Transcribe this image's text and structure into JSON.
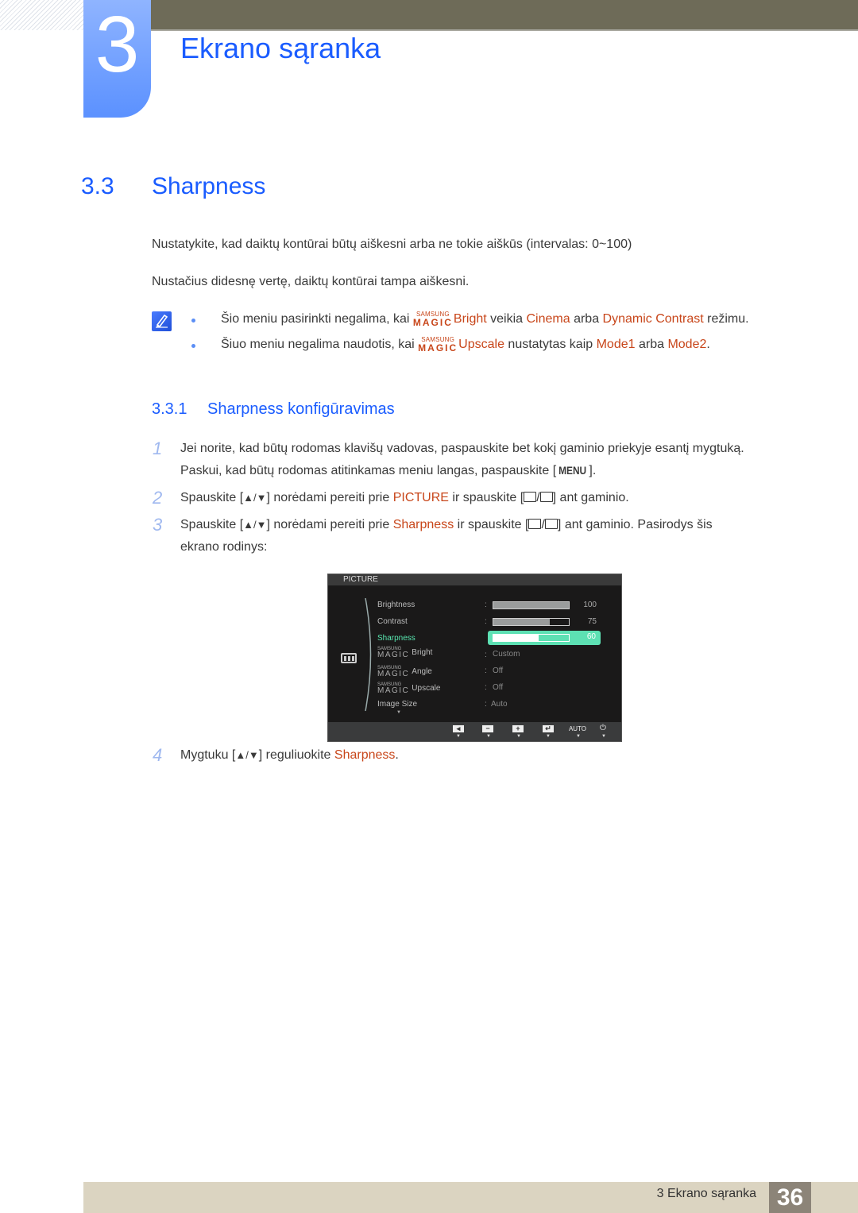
{
  "chapter": {
    "number": "3",
    "title": "Ekrano sąranka"
  },
  "section": {
    "number": "3.3",
    "title": "Sharpness"
  },
  "intro": [
    "Nustatykite, kad daiktų kontūrai būtų aiškesni arba ne tokie aiškūs (intervalas: 0~100)",
    "Nustačius didesnę vertę, daiktų kontūrai tampa aiškesni."
  ],
  "notes": [
    {
      "pre": "Šio meniu pasirinkti negalima, kai ",
      "magic_s": "SAMSUNG",
      "magic_m": "MAGIC",
      "feature": "Bright",
      "mid1": " veikia ",
      "opt1": "Cinema",
      "mid2": " arba ",
      "opt2": "Dynamic Contrast",
      "post": " režimu."
    },
    {
      "pre": "Šiuo meniu negalima naudotis, kai ",
      "magic_s": "SAMSUNG",
      "magic_m": "MAGIC",
      "feature": "Upscale",
      "mid1": " nustatytas kaip ",
      "opt1": "Mode1",
      "mid2": " arba ",
      "opt2": "Mode2",
      "post": "."
    }
  ],
  "subsection": {
    "number": "3.3.1",
    "title": "Sharpness konfigūravimas"
  },
  "steps": [
    {
      "num": "1",
      "line1": "Jei norite, kad būtų rodomas klavišų vadovas, paspauskite bet kokį gaminio priekyje esantį mygtuką.",
      "line2_pre": "Paskui, kad būtų rodomas atitinkamas meniu langas, paspauskite [",
      "key": "MENU",
      "line2_post": "]."
    },
    {
      "num": "2",
      "pre": "Spauskite [",
      "arrows": "▲/▼",
      "mid": "] norėdami pereiti prie ",
      "target": "PICTURE",
      "mid2": " ir spauskite [",
      "post": "] ant gaminio."
    },
    {
      "num": "3",
      "pre": "Spauskite [",
      "arrows": "▲/▼",
      "mid": "] norėdami pereiti prie ",
      "target": "Sharpness",
      "mid2": " ir spauskite [",
      "post": "] ant gaminio. Pasirodys šis",
      "line2": "ekrano rodinys:"
    },
    {
      "num": "4",
      "pre": "Mygtuku [",
      "arrows": "▲/▼",
      "mid": "] reguliuokite ",
      "target": "Sharpness",
      "post": "."
    }
  ],
  "osd": {
    "header": "PICTURE",
    "items": [
      {
        "label": "Brightness",
        "value": 100,
        "type": "bar"
      },
      {
        "label": "Contrast",
        "value": 75,
        "type": "bar"
      },
      {
        "label": "Sharpness",
        "value": 60,
        "type": "bar",
        "selected": true
      },
      {
        "magic_s": "SAMSUNG",
        "magic_m": "MAGIC",
        "label": "Bright",
        "value": "Custom",
        "type": "text"
      },
      {
        "magic_s": "SAMSUNG",
        "magic_m": "MAGIC",
        "label": "Angle",
        "value": "Off",
        "type": "text"
      },
      {
        "magic_s": "SAMSUNG",
        "magic_m": "MAGIC",
        "label": "Upscale",
        "value": "Off",
        "type": "text"
      },
      {
        "label": "Image Size",
        "value": "Auto",
        "type": "text"
      }
    ],
    "colon": ":",
    "more": "▼",
    "footer_buttons": [
      "left-arrow",
      "minus",
      "plus",
      "enter",
      "AUTO",
      "power"
    ],
    "footer_auto": "AUTO",
    "accent": "#5de0b3"
  },
  "footer": {
    "text": "3 Ekrano sąranka",
    "page": "36"
  }
}
